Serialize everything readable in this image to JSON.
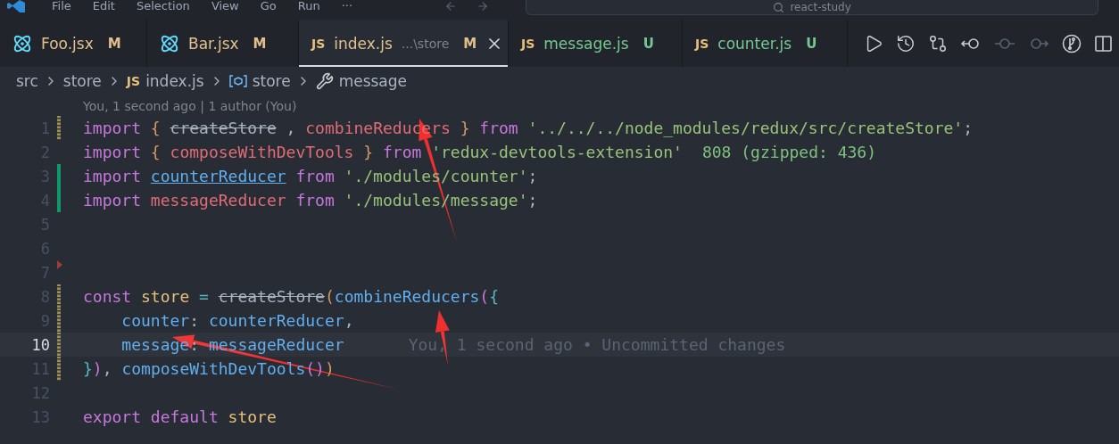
{
  "menu": [
    "File",
    "Edit",
    "Selection",
    "View",
    "Go",
    "Run",
    "···"
  ],
  "search": {
    "placeholder": "react-study"
  },
  "tabs": [
    {
      "kind": "jsx",
      "name": "Foo.jsx",
      "untracked": false,
      "status": "M",
      "selected": false
    },
    {
      "kind": "jsx",
      "name": "Bar.jsx",
      "untracked": false,
      "status": "M",
      "selected": false
    },
    {
      "kind": "js",
      "badge": "JS",
      "name": "index.js",
      "description": "...\\store",
      "untracked": false,
      "status": "M",
      "selected": true
    },
    {
      "kind": "js",
      "badge": "JS",
      "name": "message.js",
      "untracked": true,
      "status": "U",
      "selected": false
    },
    {
      "kind": "js",
      "badge": "JS",
      "name": "counter.js",
      "untracked": true,
      "status": "U",
      "selected": false
    }
  ],
  "editor_actions": [
    {
      "kind": "run",
      "disabled": false
    },
    {
      "kind": "history",
      "disabled": false
    },
    {
      "kind": "compare",
      "disabled": false
    },
    {
      "kind": "previous",
      "disabled": false
    },
    {
      "kind": "commit",
      "disabled": true
    },
    {
      "kind": "next",
      "disabled": true
    },
    {
      "kind": "branch",
      "disabled": false
    },
    {
      "kind": "split",
      "disabled": false
    }
  ],
  "breadcrumbs": [
    {
      "kind": "folder",
      "text": "src"
    },
    {
      "kind": "folder",
      "text": "store"
    },
    {
      "kind": "file",
      "badge": "JS",
      "text": "index.js"
    },
    {
      "kind": "variable",
      "text": "store"
    },
    {
      "kind": "property",
      "text": "message"
    }
  ],
  "codelens": "You, 1 second ago | 1 author (You)",
  "lines": [
    {
      "number": "1",
      "kind": "modified",
      "current": false,
      "tokens": [
        {
          "kind": "keyword",
          "text": "import "
        },
        {
          "kind": "bracket1",
          "text": "{ "
        },
        {
          "kind": "deprecated",
          "text": "createStore"
        },
        {
          "kind": "text",
          "text": " , "
        },
        {
          "kind": "variable",
          "text": "combineReducers "
        },
        {
          "kind": "bracket1",
          "text": "} "
        },
        {
          "kind": "keyword",
          "text": "from "
        },
        {
          "kind": "string",
          "text": "'../../../node_modules/redux/src/createStore'"
        },
        {
          "kind": "text",
          "text": ";"
        }
      ]
    },
    {
      "number": "2",
      "kind": "plain",
      "current": false,
      "tokens": [
        {
          "kind": "keyword",
          "text": "import "
        },
        {
          "kind": "bracket1",
          "text": "{ "
        },
        {
          "kind": "variable",
          "text": "composeWithDevTools "
        },
        {
          "kind": "bracket1",
          "text": "} "
        },
        {
          "kind": "keyword",
          "text": "from "
        },
        {
          "kind": "string",
          "text": "'redux-devtools-extension'"
        }
      ],
      "hint": {
        "kind": "size",
        "text": "808 (gzipped: 436)"
      }
    },
    {
      "number": "3",
      "kind": "added",
      "current": false,
      "tokens": [
        {
          "kind": "keyword",
          "text": "import "
        },
        {
          "kind": "link",
          "text": "counterReducer"
        },
        {
          "kind": "keyword",
          "text": " from "
        },
        {
          "kind": "string",
          "text": "'./modules/counter'"
        },
        {
          "kind": "text",
          "text": ";"
        }
      ]
    },
    {
      "number": "4",
      "kind": "added",
      "current": false,
      "tokens": [
        {
          "kind": "keyword",
          "text": "import "
        },
        {
          "kind": "variable",
          "text": "messageReducer "
        },
        {
          "kind": "keyword",
          "text": "from "
        },
        {
          "kind": "string",
          "text": "'./modules/message'"
        },
        {
          "kind": "text",
          "text": ";"
        }
      ]
    },
    {
      "number": "5",
      "kind": "plain",
      "current": false
    },
    {
      "number": "6",
      "kind": "plain",
      "current": false
    },
    {
      "number": "7",
      "kind": "deleted",
      "current": false
    },
    {
      "number": "8",
      "kind": "modified",
      "current": false,
      "tokens": [
        {
          "kind": "keyword",
          "text": "const "
        },
        {
          "kind": "constant",
          "text": "store"
        },
        {
          "kind": "operator",
          "text": " = "
        },
        {
          "kind": "deprecated",
          "text": "createStore"
        },
        {
          "kind": "bracket1",
          "text": "("
        },
        {
          "kind": "function",
          "text": "combineReducers"
        },
        {
          "kind": "bracket2",
          "text": "("
        },
        {
          "kind": "bracket3",
          "text": "{"
        }
      ]
    },
    {
      "number": "9",
      "kind": "modified",
      "current": false,
      "tokens": [
        {
          "kind": "function",
          "text": "    counter"
        },
        {
          "kind": "text",
          "text": ": "
        },
        {
          "kind": "function",
          "text": "counterReducer"
        },
        {
          "kind": "text",
          "text": ","
        }
      ]
    },
    {
      "number": "10",
      "kind": "modified",
      "current": true,
      "tokens": [
        {
          "kind": "function",
          "text": "    message"
        },
        {
          "kind": "text",
          "text": ": "
        },
        {
          "kind": "function",
          "text": "messageReducer"
        }
      ],
      "hint": {
        "kind": "blame",
        "text": "You, 1 second ago • Uncommitted changes"
      }
    },
    {
      "number": "11",
      "kind": "modified",
      "current": false,
      "tokens": [
        {
          "kind": "bracket3",
          "text": "}"
        },
        {
          "kind": "bracket2",
          "text": ")"
        },
        {
          "kind": "text",
          "text": ", "
        },
        {
          "kind": "function",
          "text": "composeWithDevTools"
        },
        {
          "kind": "bracket2",
          "text": "()"
        },
        {
          "kind": "bracket1",
          "text": ")"
        }
      ]
    },
    {
      "number": "12",
      "kind": "plain",
      "current": false
    },
    {
      "number": "13",
      "kind": "plain",
      "current": false,
      "tokens": [
        {
          "kind": "keyword",
          "text": "export "
        },
        {
          "kind": "keyword",
          "text": "default "
        },
        {
          "kind": "constant",
          "text": "store"
        }
      ]
    }
  ]
}
